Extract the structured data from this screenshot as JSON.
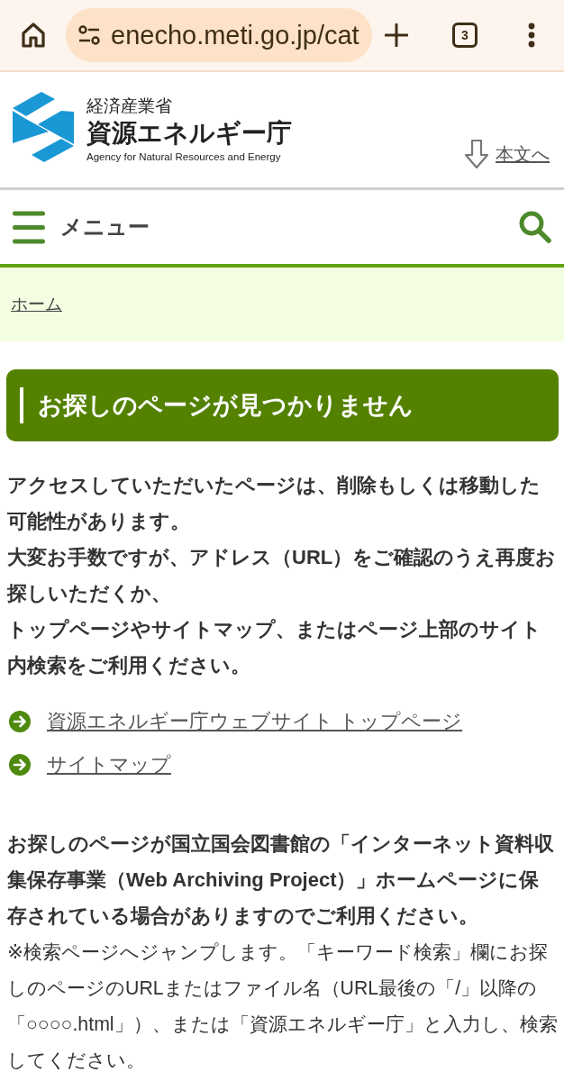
{
  "browser": {
    "url": "enecho.meti.go.jp/cat",
    "tab_count": "3"
  },
  "header": {
    "ministry": "経済産業省",
    "agency": "資源エネルギー庁",
    "agency_english": "Agency for Natural Resources and Energy",
    "skip_link": "本文へ"
  },
  "nav": {
    "menu_label": "メニュー"
  },
  "breadcrumb": [
    {
      "label": "ホーム"
    }
  ],
  "heading": "お探しのページが見つかりません",
  "message": [
    "アクセスしていただいたページは、削除もしくは移動した可能性があります。",
    "大変お手数ですが、アドレス（URL）をご確認のうえ再度お探しいただくか、",
    "トップページやサイトマップ、またはページ上部のサイト内検索をご利用ください。"
  ],
  "links": [
    {
      "label": "資源エネルギー庁ウェブサイト トップページ"
    },
    {
      "label": "サイトマップ"
    }
  ],
  "archive_notice": "お探しのページが国立国会図書館の「インターネット資料収集保存事業（Web Archiving Project）」ホームページに保存されている場合がありますのでご利用ください。",
  "search_note": "※検索ページへジャンプします。「キーワード検索」欄にお探しのページのURLまたはファイル名（URL最後の「/」以降の「○○○○.html」）、または「資源エネルギー庁」と入力し、検索してください。"
}
